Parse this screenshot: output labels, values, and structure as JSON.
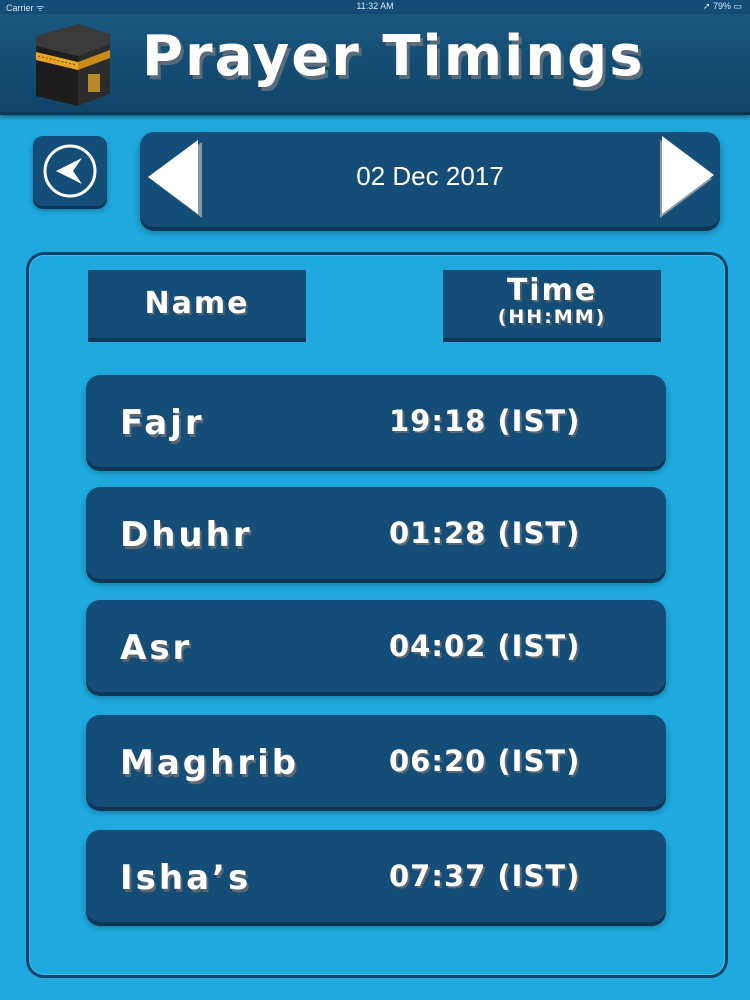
{
  "status_bar": {
    "carrier": "Carrier ᯤ",
    "time": "11:32 AM",
    "battery": "➚ 79% ▭"
  },
  "header": {
    "title": "Prayer Timings"
  },
  "date_nav": {
    "date": "02 Dec 2017"
  },
  "columns": {
    "name": "Name",
    "time": "Time",
    "time_format": "(HH:MM)"
  },
  "prayers": [
    {
      "name": "Fajr",
      "time": "19:18 (IST)"
    },
    {
      "name": "Dhuhr",
      "time": "01:28 (IST)"
    },
    {
      "name": "Asr",
      "time": "04:02 (IST)"
    },
    {
      "name": "Maghrib",
      "time": "06:20 (IST)"
    },
    {
      "name": "Isha’s",
      "time": "07:37 (IST)"
    }
  ],
  "icons": {
    "logo": "kaaba-icon",
    "back": "back-arrow-icon",
    "prev": "left-triangle-icon",
    "next": "right-triangle-icon"
  },
  "colors": {
    "background": "#1fa9df",
    "panel": "#134d78",
    "shadow": "#0b3656",
    "text": "#ffffff",
    "kaaba_band": "#e8a623"
  }
}
